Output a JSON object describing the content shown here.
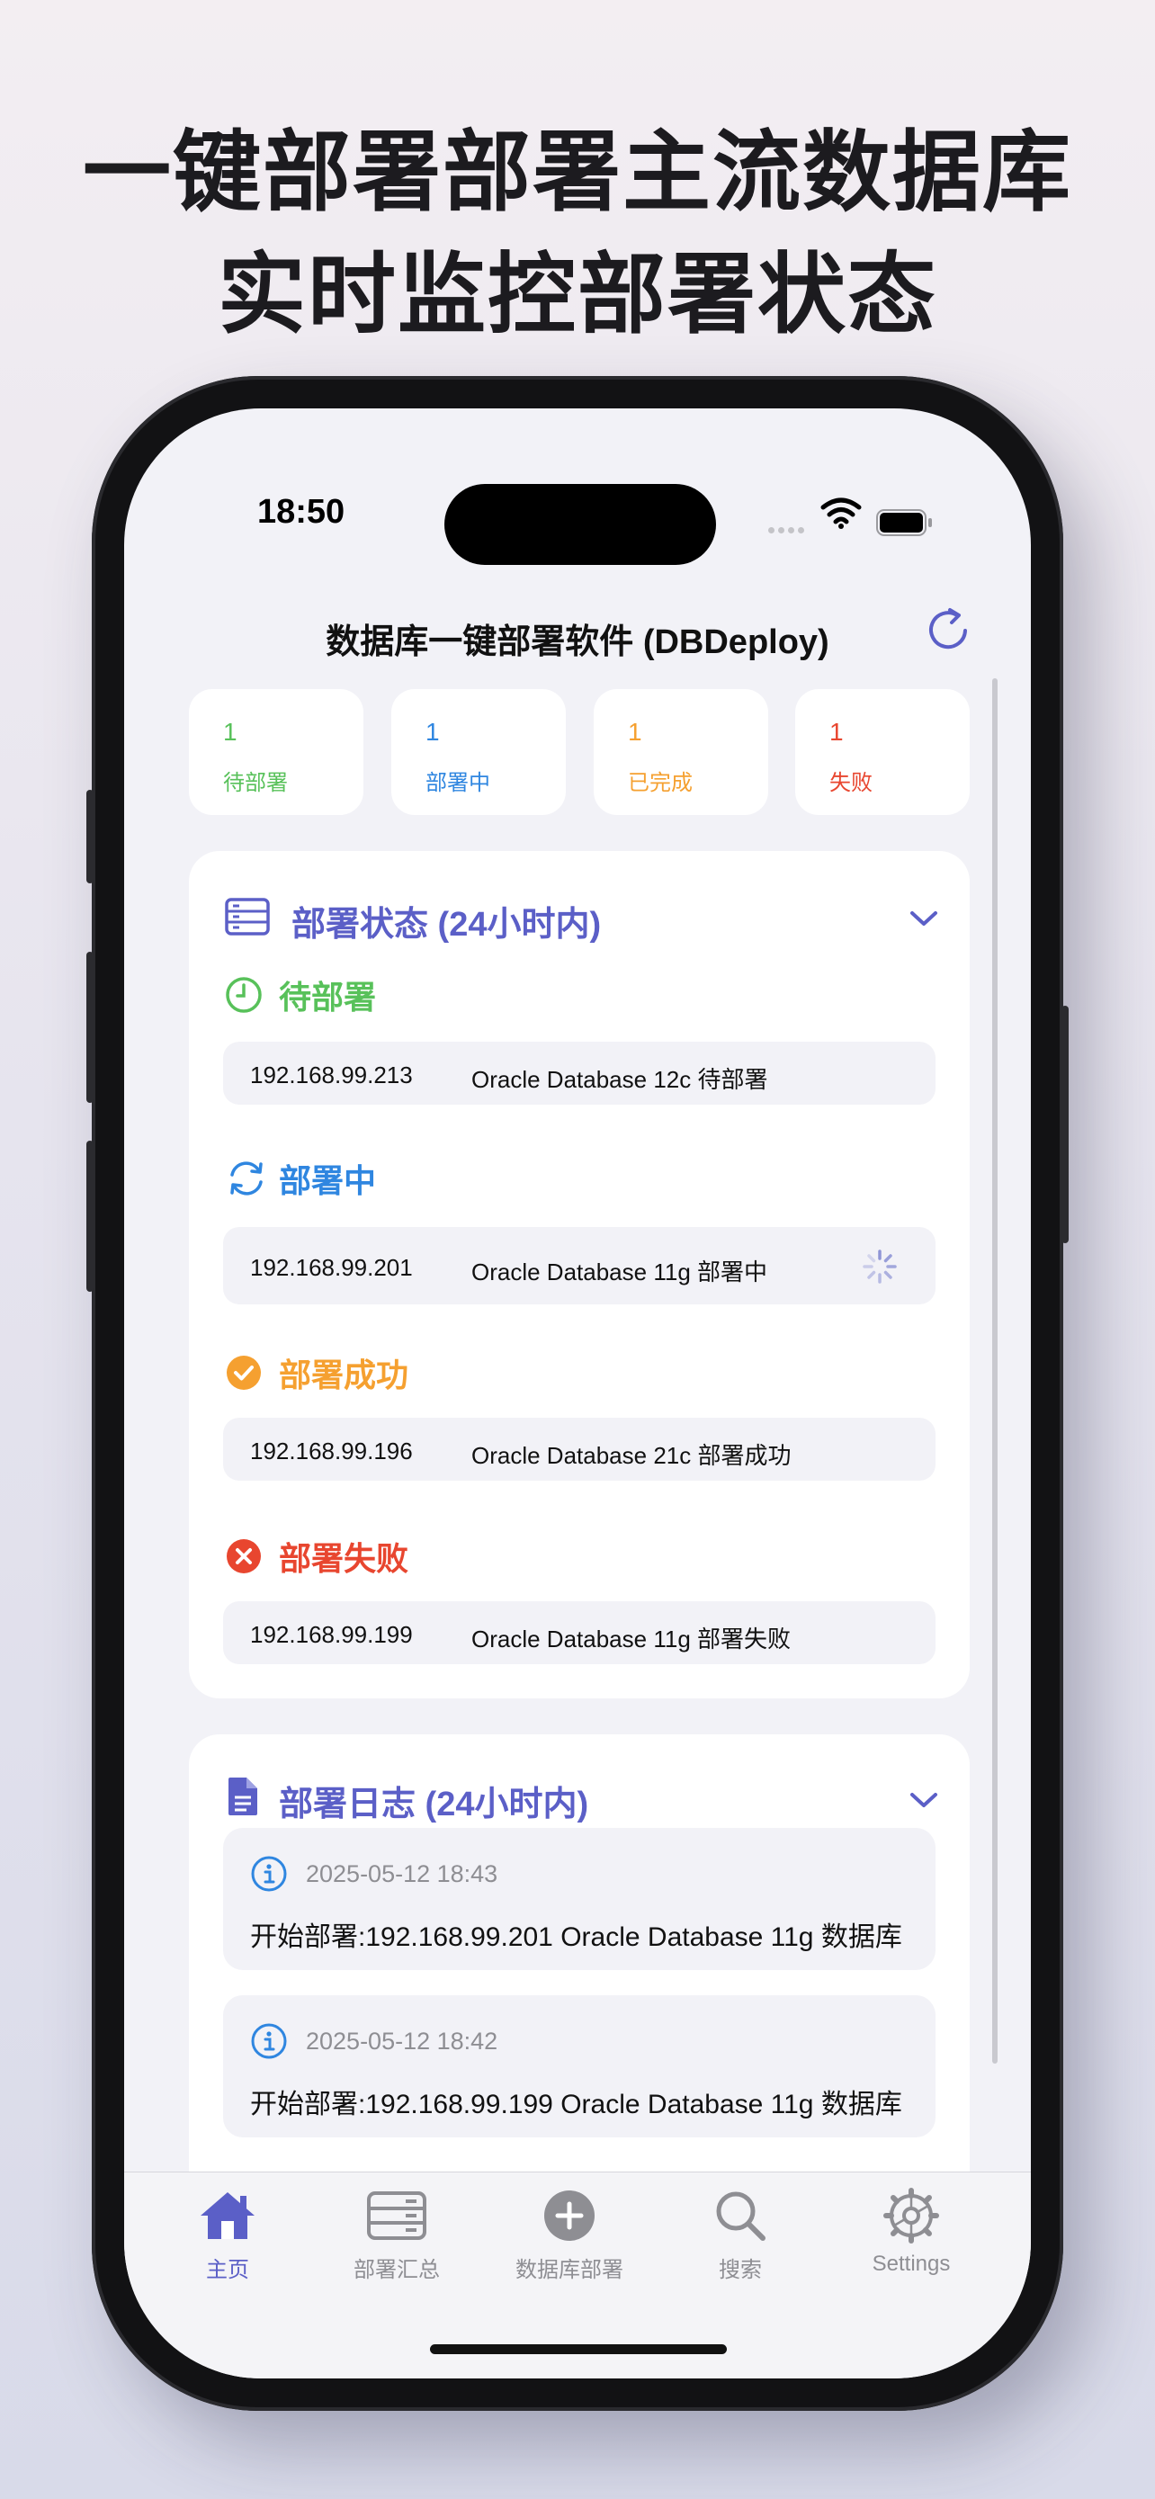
{
  "headline": {
    "line1": "一键部署部署主流数据库",
    "line2": "实时监控部署状态"
  },
  "status_bar": {
    "time": "18:50"
  },
  "nav": {
    "title": "数据库一键部署软件 (DBDeploy)"
  },
  "colors": {
    "accent": "#5b5fc7",
    "pending": "#58c15a",
    "deploying": "#2f86e0",
    "done": "#f5a030",
    "failed": "#e8462f"
  },
  "stats": [
    {
      "count": "1",
      "label": "待部署"
    },
    {
      "count": "1",
      "label": "部署中"
    },
    {
      "count": "1",
      "label": "已完成"
    },
    {
      "count": "1",
      "label": "失败"
    }
  ],
  "status_card": {
    "title": "部署状态 (24小时内)",
    "sections": [
      {
        "label": "待部署",
        "icon": "clock-icon",
        "ip": "192.168.99.213",
        "text": "Oracle Database 12c 待部署"
      },
      {
        "label": "部署中",
        "icon": "sync-icon",
        "ip": "192.168.99.201",
        "text": "Oracle Database 11g 部署中"
      },
      {
        "label": "部署成功",
        "icon": "checkmark-circle-icon",
        "ip": "192.168.99.196",
        "text": "Oracle Database 21c 部署成功"
      },
      {
        "label": "部署失败",
        "icon": "x-circle-icon",
        "ip": "192.168.99.199",
        "text": "Oracle Database 11g 部署失败"
      }
    ]
  },
  "log_card": {
    "title": "部署日志 (24小时内)",
    "entries": [
      {
        "time": "2025-05-12 18:43",
        "message": "开始部署:192.168.99.201 Oracle Database 11g 数据库"
      },
      {
        "time": "2025-05-12 18:42",
        "message": "开始部署:192.168.99.199 Oracle Database 11g 数据库"
      }
    ]
  },
  "tabs": [
    {
      "label": "主页",
      "icon": "house-icon",
      "active": true
    },
    {
      "label": "部署汇总",
      "icon": "server-icon",
      "active": false
    },
    {
      "label": "数据库部署",
      "icon": "plus-circle-icon",
      "active": false
    },
    {
      "label": "搜索",
      "icon": "search-icon",
      "active": false
    },
    {
      "label": "Settings",
      "icon": "gear-icon",
      "active": false
    }
  ]
}
